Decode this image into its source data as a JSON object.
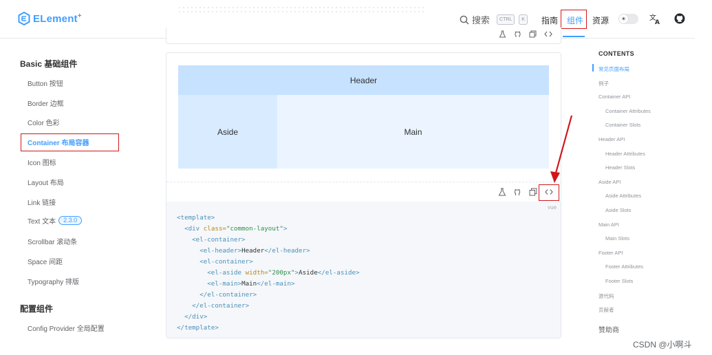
{
  "brand": {
    "name": "ELement",
    "sup": "+"
  },
  "colors": {
    "accent": "#409eff",
    "highlight_box": "#d0161b",
    "header_block": "#c6e2ff",
    "aside_block": "#d9ecff",
    "main_block": "#ecf5ff"
  },
  "topnav": {
    "search_label": "搜索",
    "kbd_ctrl": "CTRL",
    "kbd_k": "K",
    "links": [
      "指南",
      "组件",
      "资源"
    ],
    "active_link": "组件",
    "theme_icon": "sun-icon",
    "lang_icon": "translate-icon",
    "github_icon": "github-icon"
  },
  "sidebar": {
    "groups": [
      {
        "title": "Basic 基础组件",
        "items": [
          {
            "label": "Button 按钮"
          },
          {
            "label": "Border 边框"
          },
          {
            "label": "Color 色彩"
          },
          {
            "label": "Container 布局容器"
          },
          {
            "label": "Icon 图标"
          },
          {
            "label": "Layout 布局"
          },
          {
            "label": "Link 链接"
          },
          {
            "label": "Text 文本",
            "badge": "2.3.0"
          },
          {
            "label": "Scrollbar 滚动条"
          },
          {
            "label": "Space 间距"
          },
          {
            "label": "Typography 排版"
          }
        ]
      },
      {
        "title": "配置组件",
        "items": [
          {
            "label": "Config Provider 全局配置"
          }
        ]
      }
    ],
    "active_item": "Container 布局容器"
  },
  "demo": {
    "header_label": "Header",
    "aside_label": "Aside",
    "main_label": "Main",
    "toolbar_icons": [
      "playground-icon",
      "github-icon",
      "copy-icon",
      "code-icon"
    ],
    "code_lang": "vue",
    "code_lines": [
      {
        "indent": "",
        "parts": [
          {
            "t": "tg",
            "v": "<template>"
          }
        ]
      },
      {
        "indent": "  ",
        "parts": [
          {
            "t": "tg",
            "v": "<div "
          },
          {
            "t": "at",
            "v": "class="
          },
          {
            "t": "st",
            "v": "\"common-layout\""
          },
          {
            "t": "tg",
            "v": ">"
          }
        ]
      },
      {
        "indent": "    ",
        "parts": [
          {
            "t": "tg",
            "v": "<el-container>"
          }
        ]
      },
      {
        "indent": "      ",
        "parts": [
          {
            "t": "tg",
            "v": "<el-header>"
          },
          {
            "t": "tx",
            "v": "Header"
          },
          {
            "t": "tg",
            "v": "</el-header>"
          }
        ]
      },
      {
        "indent": "      ",
        "parts": [
          {
            "t": "tg",
            "v": "<el-container>"
          }
        ]
      },
      {
        "indent": "        ",
        "parts": [
          {
            "t": "tg",
            "v": "<el-aside "
          },
          {
            "t": "at",
            "v": "width="
          },
          {
            "t": "st",
            "v": "\"200px\""
          },
          {
            "t": "tg",
            "v": ">"
          },
          {
            "t": "tx",
            "v": "Aside"
          },
          {
            "t": "tg",
            "v": "</el-aside>"
          }
        ]
      },
      {
        "indent": "        ",
        "parts": [
          {
            "t": "tg",
            "v": "<el-main>"
          },
          {
            "t": "tx",
            "v": "Main"
          },
          {
            "t": "tg",
            "v": "</el-main>"
          }
        ]
      },
      {
        "indent": "      ",
        "parts": [
          {
            "t": "tg",
            "v": "</el-container>"
          }
        ]
      },
      {
        "indent": "    ",
        "parts": [
          {
            "t": "tg",
            "v": "</el-container>"
          }
        ]
      },
      {
        "indent": "  ",
        "parts": [
          {
            "t": "tg",
            "v": "</div>"
          }
        ]
      },
      {
        "indent": "",
        "parts": [
          {
            "t": "tg",
            "v": "</template>"
          }
        ]
      }
    ]
  },
  "toc": {
    "title": "CONTENTS",
    "items": [
      {
        "label": "常见页面布局",
        "level": 1,
        "active": true
      },
      {
        "label": "例子",
        "level": 1
      },
      {
        "label": "Container API",
        "level": 1
      },
      {
        "label": "Container Attributes",
        "level": 2
      },
      {
        "label": "Container Slots",
        "level": 2
      },
      {
        "label": "Header API",
        "level": 1
      },
      {
        "label": "Header Attributes",
        "level": 2
      },
      {
        "label": "Header Slots",
        "level": 2
      },
      {
        "label": "Aside API",
        "level": 1
      },
      {
        "label": "Aside Attributes",
        "level": 2
      },
      {
        "label": "Aside Slots",
        "level": 2
      },
      {
        "label": "Main API",
        "level": 1
      },
      {
        "label": "Main Slots",
        "level": 2
      },
      {
        "label": "Footer API",
        "level": 1
      },
      {
        "label": "Footer Attributes",
        "level": 2
      },
      {
        "label": "Footer Slots",
        "level": 2
      },
      {
        "label": "源代码",
        "level": 1
      },
      {
        "label": "贡献者",
        "level": 1
      }
    ],
    "sponsor": "赞助商"
  },
  "watermark": "CSDN @小啊斗"
}
